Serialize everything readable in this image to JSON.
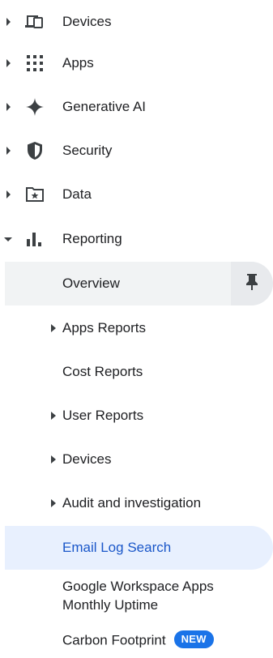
{
  "nav": {
    "top_items": [
      {
        "label": "Devices",
        "icon": "devices-icon",
        "expanded": false
      },
      {
        "label": "Apps",
        "icon": "apps-grid-icon",
        "expanded": false
      },
      {
        "label": "Generative AI",
        "icon": "sparkle-icon",
        "expanded": false
      },
      {
        "label": "Security",
        "icon": "shield-icon",
        "expanded": false
      },
      {
        "label": "Data",
        "icon": "folder-star-icon",
        "expanded": false
      },
      {
        "label": "Reporting",
        "icon": "bar-chart-icon",
        "expanded": true
      }
    ],
    "reporting_children": [
      {
        "label": "Overview",
        "state": "selected",
        "pinnable": true
      },
      {
        "label": "Apps Reports",
        "expandable": true
      },
      {
        "label": "Cost Reports",
        "expandable": false
      },
      {
        "label": "User Reports",
        "expandable": true
      },
      {
        "label": "Devices",
        "expandable": true
      },
      {
        "label": "Audit and investigation",
        "expandable": true
      },
      {
        "label": "Email Log Search",
        "state": "active"
      },
      {
        "label_line1": "Google Workspace Apps",
        "label_line2": "Monthly Uptime"
      },
      {
        "label": "Carbon Footprint",
        "badge": "NEW"
      }
    ]
  },
  "colors": {
    "active_text": "#1a57c9",
    "active_bg": "#e8f0fe",
    "selected_bg": "#f1f3f4",
    "badge_bg": "#1a73e8",
    "icon": "#3c4043"
  }
}
